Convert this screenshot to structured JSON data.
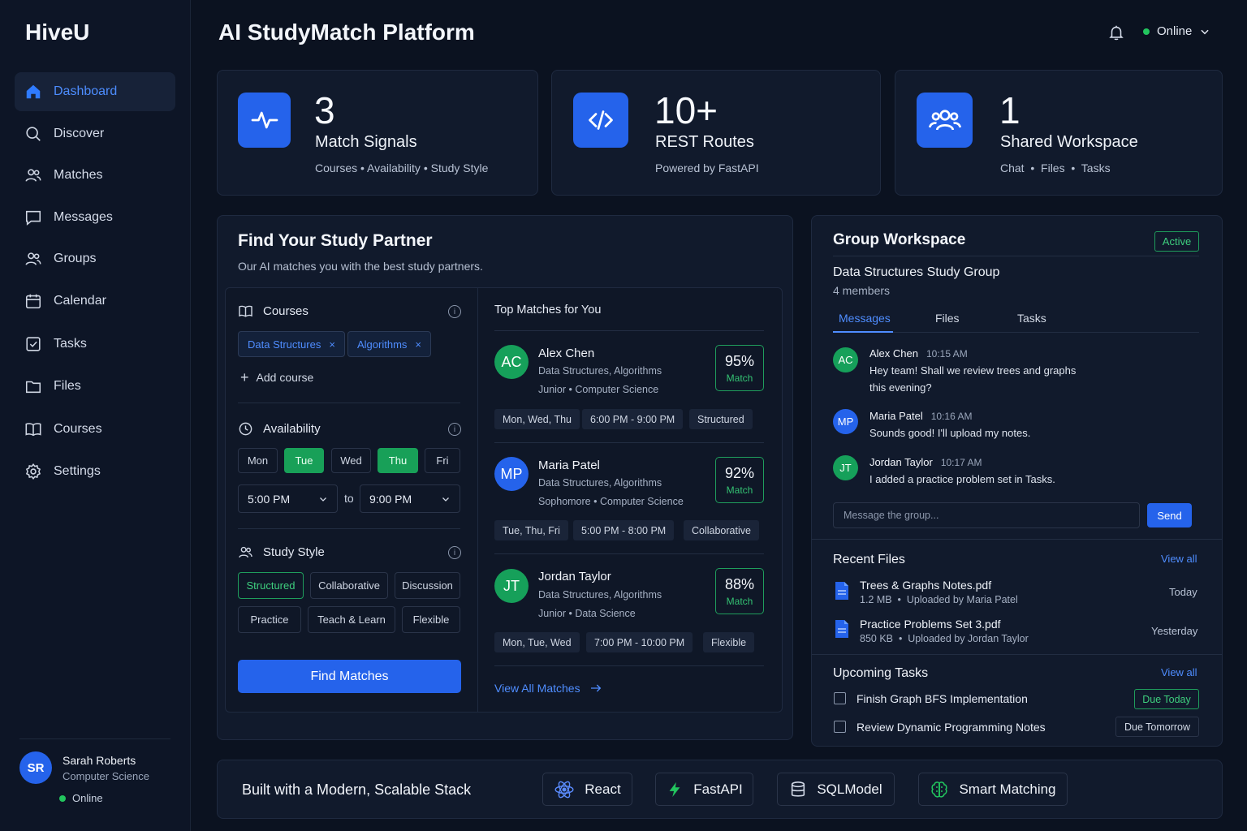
{
  "app": {
    "brand": "HiveU",
    "page_title": "AI StudyMatch Platform"
  },
  "header": {
    "status": "Online"
  },
  "sidebar": {
    "items": [
      {
        "label": "Dashboard",
        "icon": "home-icon"
      },
      {
        "label": "Discover",
        "icon": "search-icon"
      },
      {
        "label": "Matches",
        "icon": "users-icon"
      },
      {
        "label": "Messages",
        "icon": "message-icon"
      },
      {
        "label": "Groups",
        "icon": "users-icon"
      },
      {
        "label": "Calendar",
        "icon": "calendar-icon"
      },
      {
        "label": "Tasks",
        "icon": "checkbox-icon"
      },
      {
        "label": "Files",
        "icon": "folder-icon"
      },
      {
        "label": "Courses",
        "icon": "book-icon"
      },
      {
        "label": "Settings",
        "icon": "gear-icon"
      }
    ],
    "active": "Dashboard",
    "user": {
      "initials": "SR",
      "name": "Sarah Roberts",
      "dept": "Computer Science",
      "status": "Online"
    }
  },
  "stats": [
    {
      "value": "3",
      "label": "Match Signals",
      "sub": "Courses • Availability • Study Style",
      "icon": "pulse-icon"
    },
    {
      "value": "10+",
      "label": "REST Routes",
      "sub": "Powered by FastAPI",
      "icon": "code-icon"
    },
    {
      "value": "1",
      "label": "Shared Workspace",
      "sub": "Chat  •  Files  •  Tasks",
      "icon": "group-icon"
    }
  ],
  "finder": {
    "title": "Find Your Study Partner",
    "subtitle": "Our AI matches you with the best study partners.",
    "courses_label": "Courses",
    "courses": [
      "Data Structures",
      "Algorithms"
    ],
    "add_course": "Add course",
    "availability_label": "Availability",
    "days": [
      {
        "label": "Mon",
        "on": false
      },
      {
        "label": "Tue",
        "on": true
      },
      {
        "label": "Wed",
        "on": false
      },
      {
        "label": "Thu",
        "on": true
      },
      {
        "label": "Fri",
        "on": false
      }
    ],
    "time_from": "5:00 PM",
    "time_to_word": "to",
    "time_to": "9:00 PM",
    "style_label": "Study Style",
    "styles": [
      {
        "label": "Structured",
        "on": true
      },
      {
        "label": "Collaborative",
        "on": false
      },
      {
        "label": "Discussion",
        "on": false
      },
      {
        "label": "Practice",
        "on": false
      },
      {
        "label": "Teach & Learn",
        "on": false
      },
      {
        "label": "Flexible",
        "on": false
      }
    ],
    "find_button": "Find Matches",
    "matches_title": "Top Matches for You",
    "matches": [
      {
        "initials": "AC",
        "name": "Alex Chen",
        "courses": "Data Structures, Algorithms",
        "year": "Junior • Computer Science",
        "pct": "95%",
        "match_label": "Match",
        "days": "Mon, Wed, Thu",
        "time": "6:00 PM - 9:00 PM",
        "style": "Structured"
      },
      {
        "initials": "MP",
        "name": "Maria Patel",
        "courses": "Data Structures, Algorithms",
        "year": "Sophomore • Computer Science",
        "pct": "92%",
        "match_label": "Match",
        "days": "Tue, Thu, Fri",
        "time": "5:00 PM - 8:00 PM",
        "style": "Collaborative"
      },
      {
        "initials": "JT",
        "name": "Jordan Taylor",
        "courses": "Data Structures, Algorithms",
        "year": "Junior • Data Science",
        "pct": "88%",
        "match_label": "Match",
        "days": "Mon, Tue, Wed",
        "time": "7:00 PM - 10:00 PM",
        "style": "Flexible"
      }
    ],
    "view_all": "View All Matches"
  },
  "workspace": {
    "title": "Group Workspace",
    "badge": "Active",
    "group_name": "Data Structures Study Group",
    "members": "4 members",
    "tabs": [
      "Messages",
      "Files",
      "Tasks"
    ],
    "messages": [
      {
        "initials": "AC",
        "name": "Alex Chen",
        "time": "10:15 AM",
        "text1": "Hey team! Shall we review trees and graphs",
        "text2": "this evening?"
      },
      {
        "initials": "MP",
        "name": "Maria Patel",
        "time": "10:16 AM",
        "text1": "Sounds good! I'll upload my notes.",
        "text2": ""
      },
      {
        "initials": "JT",
        "name": "Jordan Taylor",
        "time": "10:17 AM",
        "text1": "I added a practice problem set in Tasks.",
        "text2": ""
      }
    ],
    "input_placeholder": "Message the group...",
    "send": "Send",
    "files_title": "Recent Files",
    "files_view_all": "View all",
    "files": [
      {
        "name": "Trees & Graphs Notes.pdf",
        "meta": "1.2 MB  •  Uploaded by Maria Patel",
        "date": "Today"
      },
      {
        "name": "Practice Problems Set 3.pdf",
        "meta": "850 KB  •  Uploaded by Jordan Taylor",
        "date": "Yesterday"
      }
    ],
    "tasks_title": "Upcoming Tasks",
    "tasks_view_all": "View all",
    "tasks": [
      {
        "text": "Finish Graph BFS Implementation",
        "due": "Due Today"
      },
      {
        "text": "Review Dynamic Programming Notes",
        "due": "Due Tomorrow"
      }
    ]
  },
  "stack": {
    "title": "Built with a Modern, Scalable Stack",
    "items": [
      {
        "label": "React",
        "icon": "react-icon"
      },
      {
        "label": "FastAPI",
        "icon": "bolt-icon"
      },
      {
        "label": "SQLModel",
        "icon": "database-icon"
      },
      {
        "label": "Smart Matching",
        "icon": "brain-icon"
      }
    ]
  },
  "colors": {
    "accent": "#2563eb",
    "success": "#18a058",
    "background": "#0b1220",
    "card": "#111a2c"
  }
}
